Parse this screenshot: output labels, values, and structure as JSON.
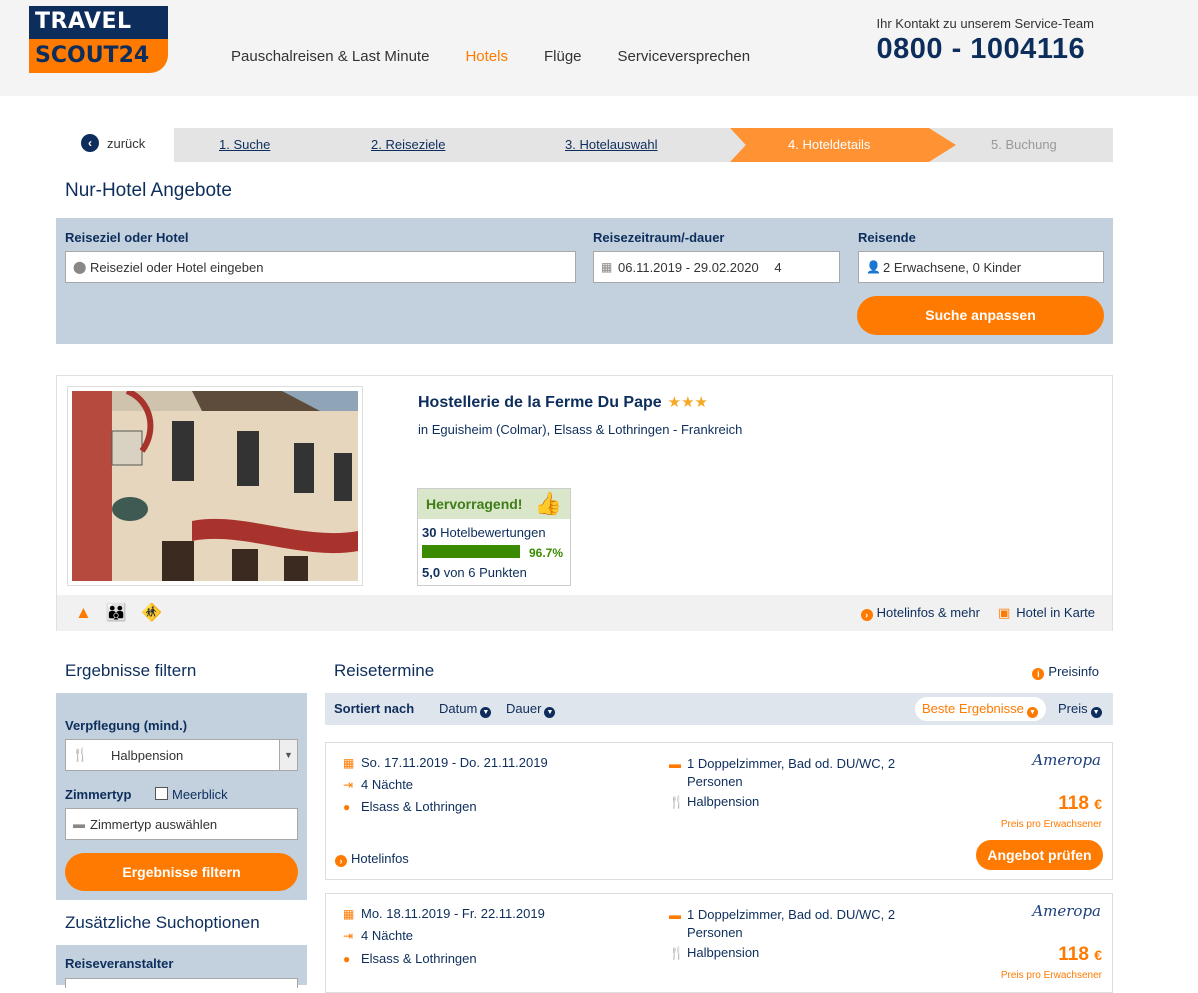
{
  "header": {
    "logo_top": "TRAVEL",
    "logo_bottom": "SCOUT24",
    "nav": [
      "Pauschalreisen & Last Minute",
      "Hotels",
      "Flüge",
      "Serviceversprechen"
    ],
    "contact_label": "Ihr Kontakt zu unserem Service-Team",
    "phone": "0800 - 1004116"
  },
  "steps": {
    "back": "zurück",
    "step1": "1. Suche",
    "step2": "2. Reiseziele",
    "step3": "3. Hotelauswahl",
    "step4": "4. Hoteldetails",
    "step5": "5. Buchung"
  },
  "page_title": "Nur-Hotel Angebote",
  "search": {
    "dest_label": "Reiseziel oder Hotel",
    "dest_placeholder": "Reiseziel oder Hotel eingeben",
    "period_label": "Reisezeitraum/-dauer",
    "period_value": "06.11.2019 - 29.02.2020",
    "duration_value": "4",
    "travelers_label": "Reisende",
    "travelers_value": "2 Erwachsene, 0 Kinder",
    "submit": "Suche anpassen"
  },
  "hotel": {
    "name": "Hostellerie de la Ferme Du Pape",
    "stars": "★★★",
    "location": "in Eguisheim (Colmar), Elsass & Lothringen - Frankreich",
    "rating_label": "Hervorragend!",
    "reviews_count": "30",
    "reviews_label": "Hotelbewertungen",
    "recommend_pct": "96.7%",
    "recommend_value": 0.967,
    "score": "5,0",
    "score_label": "von 6 Punkten",
    "link_info": "Hotelinfos & mehr",
    "link_map": "Hotel in Karte"
  },
  "filter": {
    "title": "Ergebnisse filtern",
    "board_label": "Verpflegung (mind.)",
    "board_value": "Halbpension",
    "room_label": "Zimmertyp",
    "seaview_label": "Meerblick",
    "room_placeholder": "Zimmertyp auswählen",
    "submit": "Ergebnisse filtern",
    "extra_title": "Zusätzliche Suchoptionen",
    "operator_label": "Reiseveranstalter"
  },
  "results": {
    "title": "Reisetermine",
    "priceinfo": "Preisinfo",
    "sorted_by": "Sortiert nach",
    "sort_date": "Datum",
    "sort_duration": "Dauer",
    "sort_best": "Beste Ergebnisse",
    "sort_price": "Preis",
    "offers": [
      {
        "dates": "So. 17.11.2019 - Do. 21.11.2019",
        "nights": "4 Nächte",
        "region": "Elsass & Lothringen",
        "room_line1": "1 Doppelzimmer, Bad od. DU/WC, 2",
        "room_line2": "Personen",
        "board": "Halbpension",
        "provider": "Ameropa",
        "price": "118",
        "currency": "€",
        "price_note": "Preis pro Erwachsener",
        "info_link": "Hotelinfos",
        "cta": "Angebot prüfen"
      },
      {
        "dates": "Mo. 18.11.2019 - Fr. 22.11.2019",
        "nights": "4 Nächte",
        "region": "Elsass & Lothringen",
        "room_line1": "1 Doppelzimmer, Bad od. DU/WC, 2",
        "room_line2": "Personen",
        "board": "Halbpension",
        "provider": "Ameropa",
        "price": "118",
        "currency": "€",
        "price_note": "Preis pro Erwachsener"
      }
    ]
  },
  "colors": {
    "brand_navy": "#0d2e5c",
    "brand_orange": "#ff7a00",
    "panel_blue": "#c3d1de",
    "rating_green": "#3a8b00"
  }
}
